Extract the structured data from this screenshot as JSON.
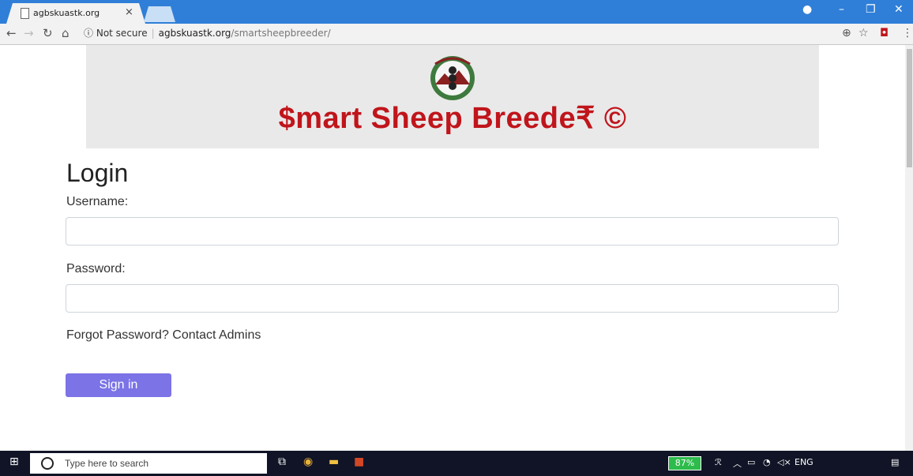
{
  "browser": {
    "tab_title": "agbskuastk.org",
    "tab_close": "×",
    "security_label": "Not secure",
    "url_host": "agbskuastk.org",
    "url_path": "/smartsheepbreeder/"
  },
  "page": {
    "brand_text": "$mart Sheep Breede₹ ©",
    "login_title": "Login",
    "username_label": "Username:",
    "username_value": "",
    "password_label": "Password:",
    "password_value": "",
    "forgot_text": "Forgot Password? Contact Admins",
    "signin_label": "Sign in"
  },
  "taskbar": {
    "search_placeholder": "Type here to search",
    "battery": "87%",
    "language": "ENG"
  },
  "colors": {
    "tab_strip": "#2f7fd8",
    "brand_red": "#c0151b",
    "signin_button": "#7b73e6",
    "taskbar": "#101426"
  },
  "icons": {
    "tab": "page-icon",
    "back": "back-arrow-icon",
    "forward": "forward-arrow-icon",
    "reload": "reload-icon",
    "home": "home-icon",
    "info": "info-icon",
    "zoom": "zoom-icon",
    "bookmark": "star-icon",
    "extension": "extension-icon",
    "menu": "kebab-menu-icon",
    "windows": "windows-logo-icon",
    "mic": "microphone-icon",
    "taskview": "task-view-icon",
    "chrome": "chrome-icon",
    "explorer": "file-explorer-icon",
    "powerpoint": "powerpoint-icon",
    "notifications": "notification-icon"
  }
}
